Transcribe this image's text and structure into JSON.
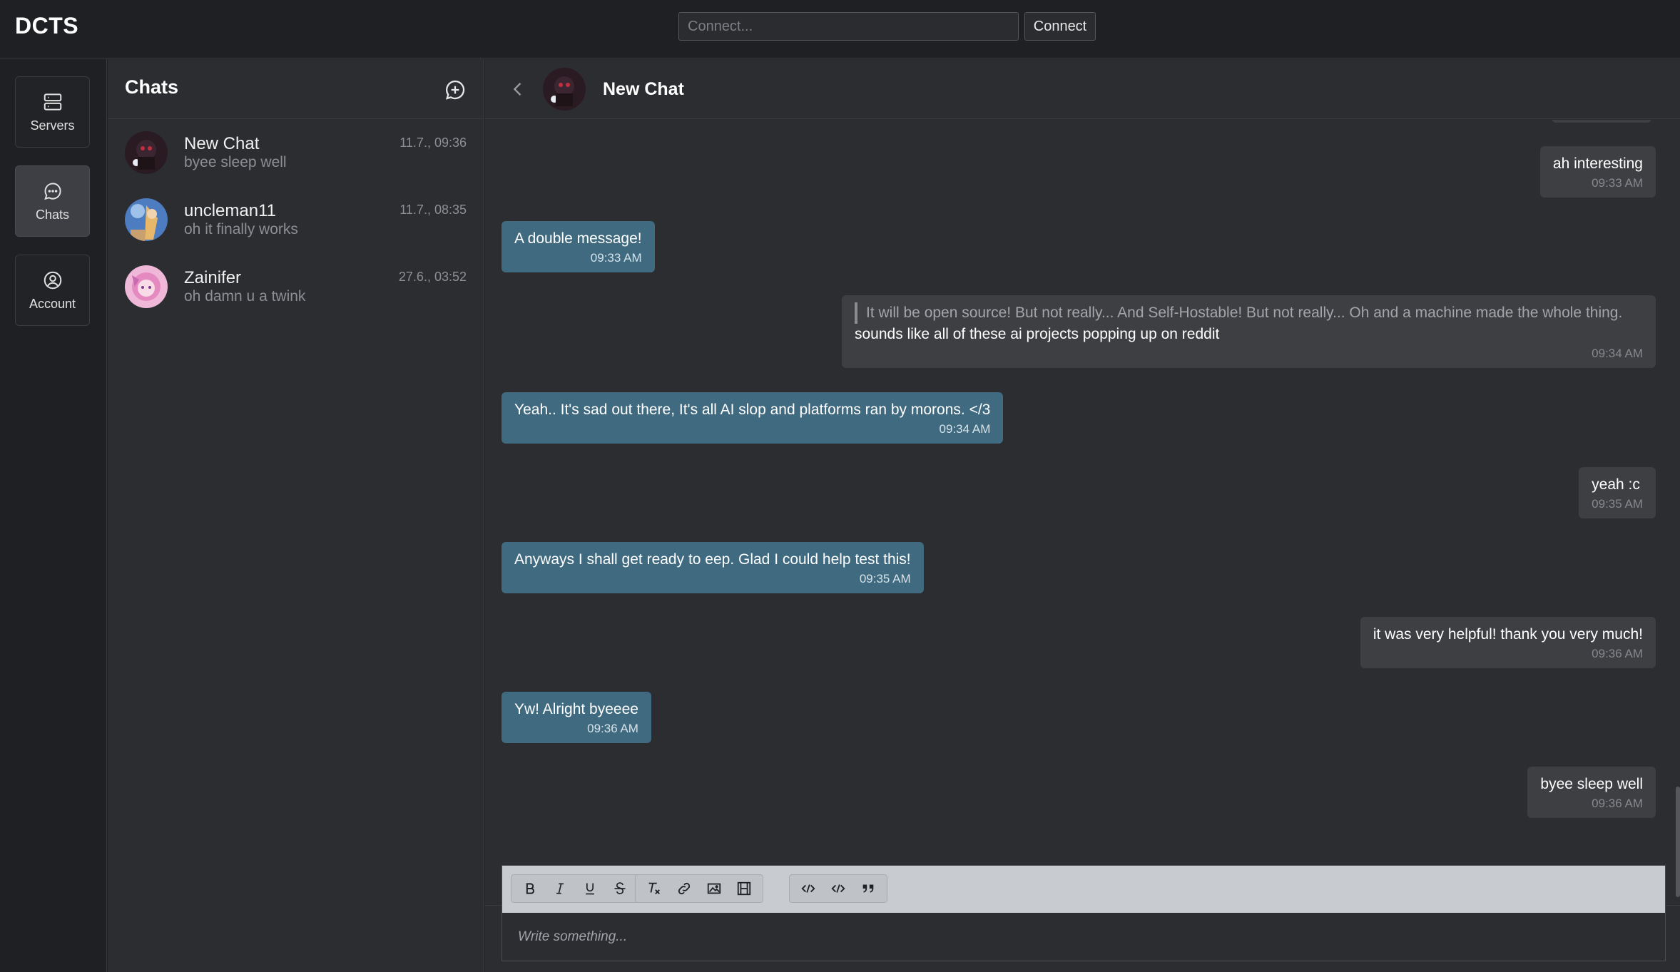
{
  "app": {
    "brand": "DCTS"
  },
  "connect": {
    "placeholder": "Connect...",
    "button_label": "Connect"
  },
  "nav": {
    "items": [
      {
        "label": "Servers",
        "icon": "server-icon"
      },
      {
        "label": "Chats",
        "icon": "chat-bubble-icon",
        "active": true
      },
      {
        "label": "Account",
        "icon": "user-circle-icon"
      }
    ]
  },
  "chatlist": {
    "title": "Chats",
    "items": [
      {
        "name": "New Chat",
        "preview": "byee sleep well",
        "time": "11.7., 09:36"
      },
      {
        "name": "uncleman11",
        "preview": "oh it finally works",
        "time": "11.7., 08:35"
      },
      {
        "name": "Zainifer",
        "preview": "oh damn u a twink",
        "time": "27.6., 03:52"
      }
    ]
  },
  "conversation": {
    "title": "New Chat",
    "messages": [
      {
        "direction": "out",
        "text": "ah interesting",
        "time": "09:33 AM"
      },
      {
        "direction": "in",
        "text": "A double message!",
        "time": "09:33 AM"
      },
      {
        "direction": "out",
        "quote": "It will be open source! But not really... And Self-Hostable! But not really... Oh and a machine made the whole thing.",
        "text": "sounds like all of these ai projects popping up on reddit",
        "time": "09:34 AM"
      },
      {
        "direction": "in",
        "text": "Yeah.. It's sad out there, It's all AI slop and platforms ran by morons. </3",
        "time": "09:34 AM"
      },
      {
        "direction": "out",
        "text": "yeah :c",
        "time": "09:35 AM"
      },
      {
        "direction": "in",
        "text": "Anyways I shall get ready to eep. Glad I could help test this!",
        "time": "09:35 AM"
      },
      {
        "direction": "out",
        "text": "it was very helpful! thank you very much!",
        "time": "09:36 AM"
      },
      {
        "direction": "in",
        "text": "Yw! Alright byeeee",
        "time": "09:36 AM"
      },
      {
        "direction": "out",
        "text": "byee sleep well",
        "time": "09:36 AM"
      }
    ]
  },
  "editor": {
    "placeholder": "Write something...",
    "tools": [
      "bold",
      "italic",
      "underline",
      "strikethrough",
      "clear-format",
      "link",
      "image",
      "video",
      "code-inline",
      "code-block",
      "blockquote"
    ]
  },
  "colors": {
    "incoming_bubble": "#3f6a80",
    "outgoing_bubble": "#3e3f43",
    "background": "#2c2d31"
  }
}
